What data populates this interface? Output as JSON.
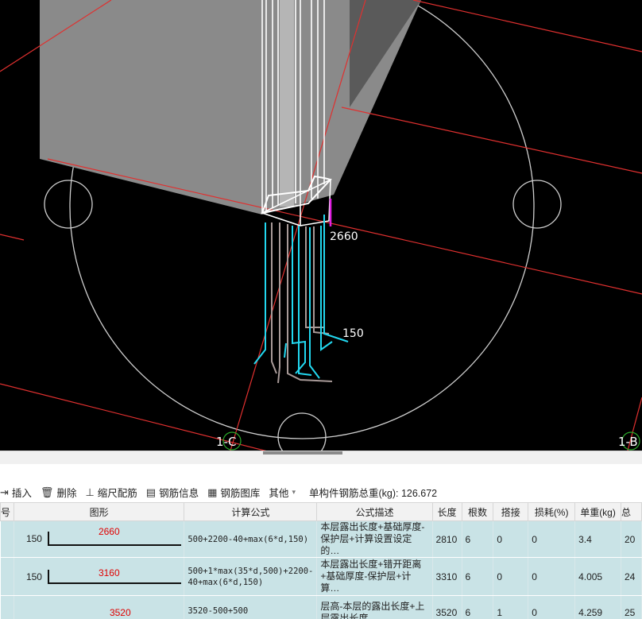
{
  "viewport": {
    "dimension_labels": [
      "2660",
      "150"
    ],
    "axis_labels": [
      "1-C",
      "1-B"
    ]
  },
  "toolbar": {
    "insert_label": "插入",
    "delete_label": "删除",
    "scale_label": "缩尺配筋",
    "rebar_info_label": "钢筋信息",
    "rebar_library_label": "钢筋图库",
    "other_label": "其他",
    "summary_label": "单构件钢筋总重(kg): 126.672"
  },
  "table": {
    "headers": [
      "号",
      "图形",
      "计算公式",
      "公式描述",
      "长度",
      "根数",
      "搭接",
      "损耗(%)",
      "单重(kg)",
      "总"
    ],
    "rows": [
      {
        "shape_left": "150",
        "shape_length": "2660",
        "formula": "500+2200-40+max(6*d,150)",
        "description": "本层露出长度+基础厚度-保护层+计算设置设定的…",
        "length": "2810",
        "count": "6",
        "lap": "0",
        "loss": "0",
        "unit_weight": "3.4",
        "total": "20"
      },
      {
        "shape_left": "150",
        "shape_length": "3160",
        "formula": "500+1*max(35*d,500)+2200-40+max(6*d,150)",
        "description": "本层露出长度+错开距离+基础厚度-保护层+计算…",
        "length": "3310",
        "count": "6",
        "lap": "0",
        "loss": "0",
        "unit_weight": "4.005",
        "total": "24"
      },
      {
        "shape_left": "",
        "shape_length": "3520",
        "formula": "3520-500+500",
        "description": "层高-本层的露出长度+上层露出长度",
        "length": "3520",
        "count": "6",
        "lap": "1",
        "loss": "0",
        "unit_weight": "4.259",
        "total": "25"
      }
    ]
  },
  "colors": {
    "viewport_bg": "#000000",
    "grid_line": "#e0302f",
    "rebar_cyan": "#22d8f0",
    "rebar_grey": "#a89a98",
    "column_white": "#ffffff",
    "dimension_magenta": "#e020e0",
    "row_bg": "#c9e3e6",
    "shape_length_red": "#e00000"
  }
}
